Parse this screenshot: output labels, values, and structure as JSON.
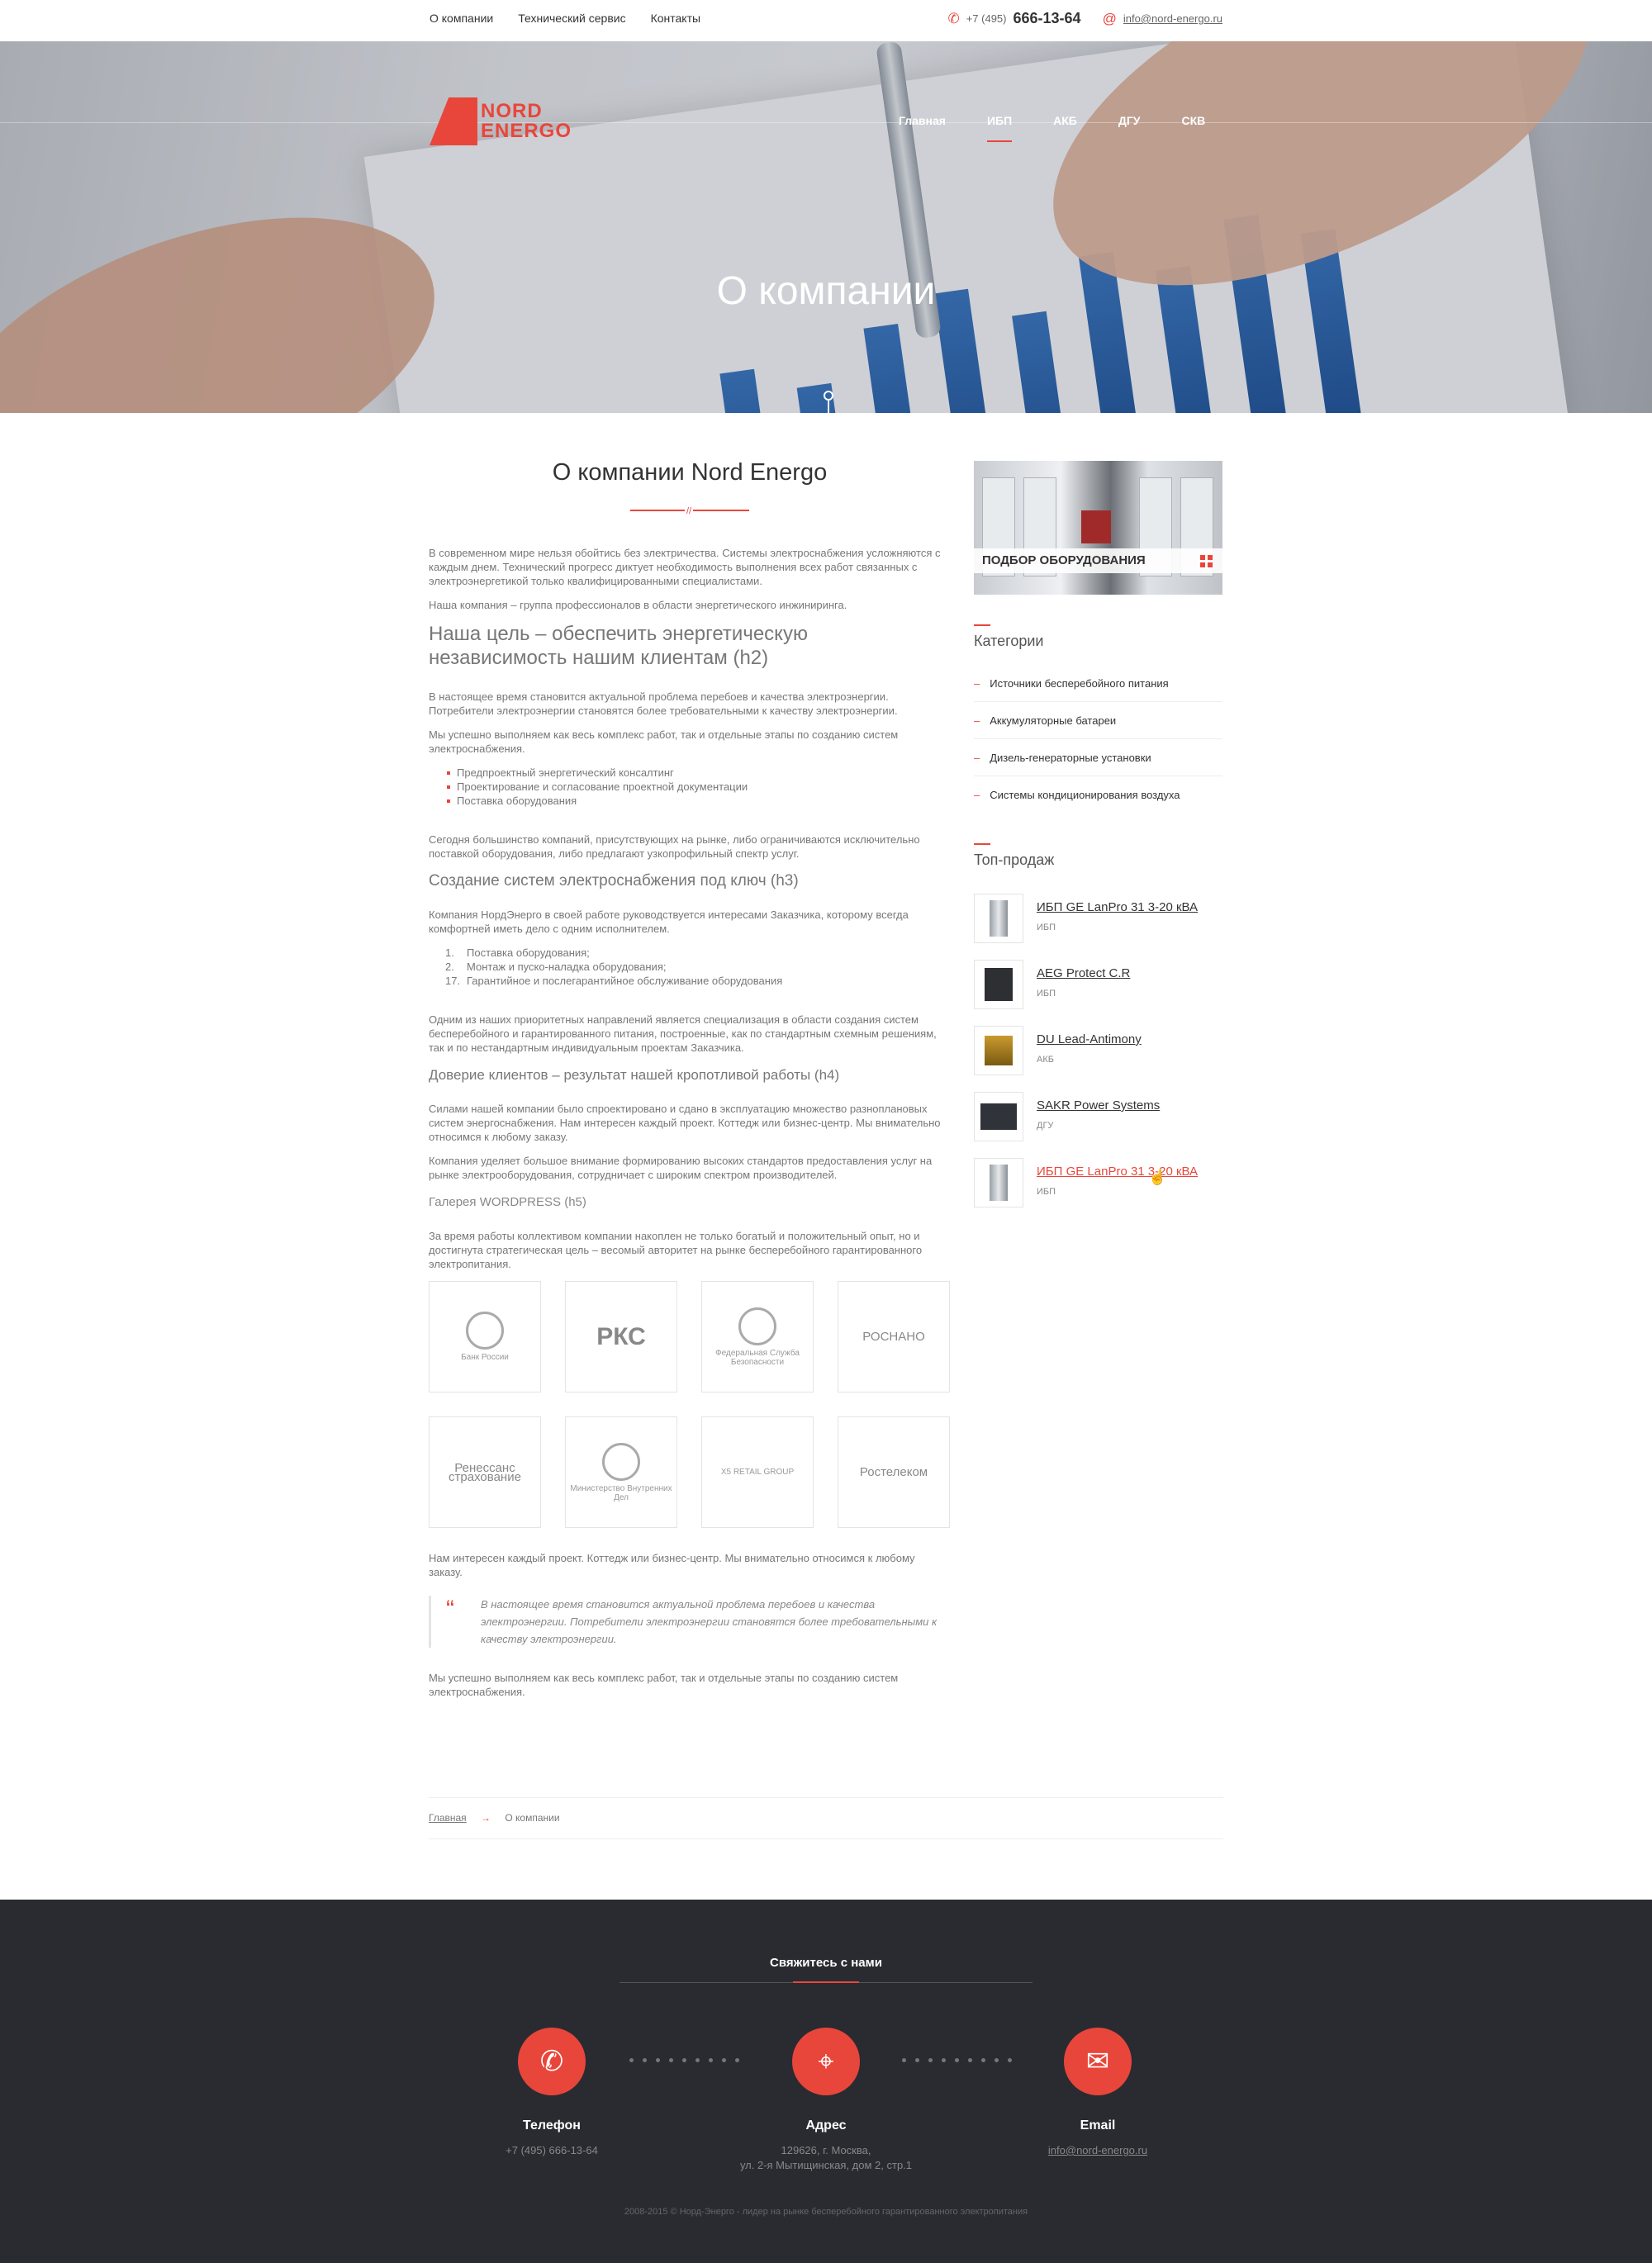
{
  "topbar": {
    "links": [
      "О компании",
      "Технический сервис",
      "Контакты"
    ],
    "phone_prefix": "+7 (495)",
    "phone_main": "666-13-64",
    "email": "info@nord-energo.ru"
  },
  "header": {
    "logo_line1": "NORD",
    "logo_line2": "ENERGO",
    "nav": [
      "Главная",
      "ИБП",
      "АКБ",
      "ДГУ",
      "СКВ"
    ],
    "active_nav": "ИБП"
  },
  "hero": {
    "title": "О компании"
  },
  "content": {
    "title": "О компании Nord Energo",
    "p1": "В современном мире нельзя обойтись без электричества. Системы электроснабжения усложняются с каждым днем. Технический прогресс диктует необходимость выполнения всех работ связанных с электроэнергетикой только квалифицированными специалистами.",
    "p2": "Наша компания – группа профессионалов в области энергетического инжиниринга.",
    "h2": "Наша цель – обеспечить энергетическую независимость нашим клиентам (h2)",
    "p3": "В настоящее время становится актуальной проблема перебоев и качества электроэнергии. Потребители электроэнергии становятся более требовательными к качеству электроэнергии.",
    "p4": "Мы успешно выполняем как весь комплекс работ, так и отдельные этапы по созданию систем электроснабжения.",
    "bullets": [
      "Предпроектный энергетический консалтинг",
      "Проектирование и согласование проектной документации",
      "Поставка оборудования"
    ],
    "p5": "Сегодня большинство компаний, присутствующих на рынке, либо ограничиваются исключительно поставкой оборудования, либо предлагают узкопрофильный спектр услуг.",
    "h3": "Создание систем электроснабжения под ключ (h3)",
    "p6": "Компания НордЭнерго в своей работе руководствуется интересами Заказчика, которому всегда комфортней иметь дело с одним исполнителем.",
    "ordered": [
      {
        "num": "1.",
        "text": "Поставка оборудования;"
      },
      {
        "num": "2.",
        "text": "Монтаж и пуско-наладка оборудования;"
      },
      {
        "num": "17.",
        "text": "Гарантийное и послегарантийное обслуживание оборудования"
      }
    ],
    "p7": "Одним из наших приоритетных направлений является специализация в области создания систем бесперебойного и гарантированного питания, построенные, как по стандартным схемным решениям, так и по нестандартным индивидуальным проектам Заказчика.",
    "h4": "Доверие клиентов – результат нашей кропотливой работы (h4)",
    "p8": "Силами нашей компании было спроектировано и сдано в эксплуатацию множество разноплановых систем энергоснабжения. Нам интересен каждый проект. Коттедж или бизнес-центр. Мы внимательно относимся к любому заказу.",
    "p9": "Компания уделяет большое внимание формированию высоких стандартов предоставления услуг на рынке электрооборудования, сотрудничает с широким спектром производителей.",
    "h5": "Галерея WORDPRESS (h5)",
    "p10": "За время работы коллективом компании накоплен не только богатый и положительный опыт, но и достигнута стратегическая цель – весомый авторитет на рынке бесперебойного гарантированного электропитания.",
    "gallery": [
      {
        "name": "Банк России",
        "kind": "emblem"
      },
      {
        "name": "РКС",
        "kind": "big"
      },
      {
        "name": "Федеральная Служба Безопасности",
        "kind": "emblem"
      },
      {
        "name": "РОСНАНО",
        "kind": "mid"
      },
      {
        "name": "Ренессанс страхование",
        "kind": "mid"
      },
      {
        "name": "Министерство Внутренних Дел",
        "kind": "emblem"
      },
      {
        "name": "X5 RETAIL GROUP",
        "kind": "small"
      },
      {
        "name": "Ростелеком",
        "kind": "mid"
      }
    ],
    "p11": "Нам интересен каждый проект. Коттедж или бизнес-центр. Мы внимательно относимся к любому заказу.",
    "quote": "В настоящее время становится актуальной проблема перебоев и качества электроэнергии. Потребители электроэнергии становятся более требовательными к качеству электроэнергии.",
    "p12": "Мы успешно выполняем как весь комплекс работ, так и отдельные этапы по созданию систем электроснабжения."
  },
  "sidebar": {
    "promo_label": "ПОДБОР ОБОРУДОВАНИЯ",
    "categories_title": "Категории",
    "categories": [
      "Источники бесперебойного питания",
      "Аккумуляторные батареи",
      "Дизель-генераторные установки",
      "Системы кондиционирования воздуха"
    ],
    "top_title": "Топ-продаж",
    "products": [
      {
        "name": "ИБП GE LanPro 31 3-20 кВА",
        "tag": "ИБП",
        "thumb": "box"
      },
      {
        "name": "AEG Protect C.R",
        "tag": "ИБП",
        "thumb": "box dark"
      },
      {
        "name": "DU Lead-Antimony",
        "tag": "АКБ",
        "thumb": "box gold"
      },
      {
        "name": "SAKR Power Systems",
        "tag": "ДГУ",
        "thumb": "box gen"
      },
      {
        "name": "ИБП GE LanPro 31 3-20 кВА",
        "tag": "ИБП",
        "thumb": "box"
      }
    ]
  },
  "breadcrumb": {
    "home": "Главная",
    "current": "О компании"
  },
  "footer": {
    "title": "Свяжитесь с нами",
    "phone_label": "Телефон",
    "phone_value": "+7 (495) 666-13-64",
    "address_label": "Адрес",
    "address_line1": "129626, г. Москва,",
    "address_line2": "ул. 2-я Мытищинская, дом 2, стр.1",
    "email_label": "Email",
    "email_value": "info@nord-energo.ru",
    "copyright": "2008-2015 © Норд-Энерго - лидер на рынке бесперебойного гарантированного электропитания"
  },
  "colors": {
    "accent": "#e8463b",
    "footer_bg": "#292b31"
  }
}
